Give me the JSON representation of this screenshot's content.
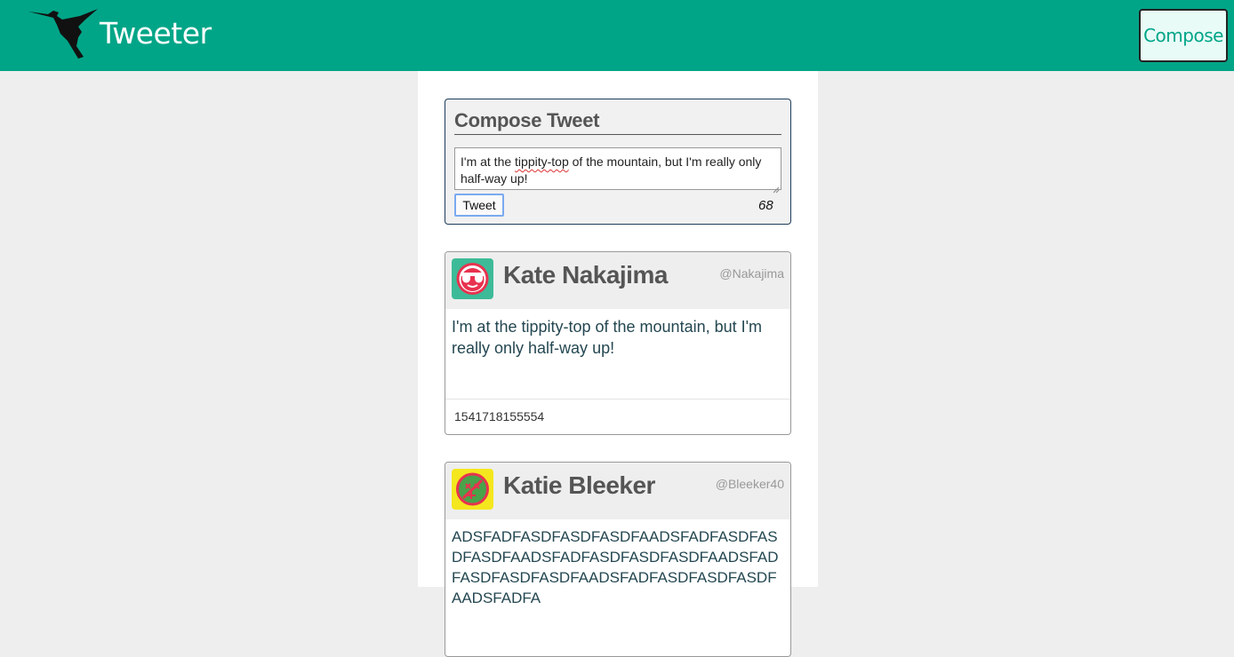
{
  "nav": {
    "brand": "Tweeter",
    "compose_label": "Compose"
  },
  "compose": {
    "title": "Compose Tweet",
    "text_before": "I'm at the ",
    "text_misspelled": "tippity-top",
    "text_after": " of the mountain, but I'm really only half-way up!",
    "button_label": "Tweet",
    "counter": "68"
  },
  "tweets": [
    {
      "name": "Kate Nakajima",
      "handle": "@Nakajima",
      "body": "I'm at the tippity-top of the mountain, but I'm really only half-way up!",
      "timestamp": "1541718155554",
      "avatar_bg": "#3dbb98",
      "avatar_icon": "sunglasses-face-icon"
    },
    {
      "name": "Katie Bleeker",
      "handle": "@Bleeker40",
      "body": "ADSFADFASDFASDFASDFAADSFADFASDFASDFASDFAADSFADFASDFASDFASDFAADSFADFASDFASDFASDFAADSFADFASDFASDFASDFAADSFADFA",
      "avatar_bg": "#f4e71e",
      "avatar_icon": "dizzy-face-icon"
    }
  ],
  "colors": {
    "brand": "#00a587",
    "background": "#eeeeee",
    "text": "#244751"
  }
}
